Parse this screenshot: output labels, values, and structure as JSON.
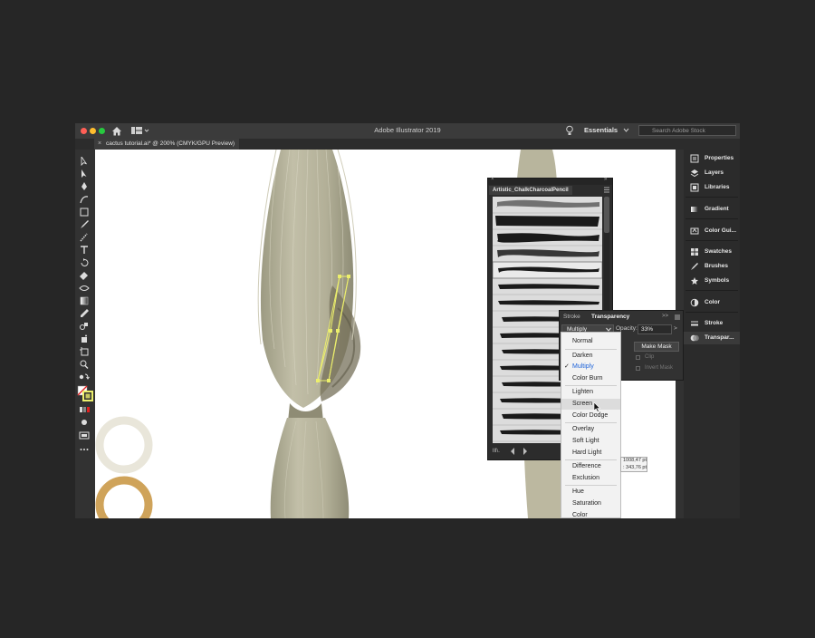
{
  "window": {
    "title": "Adobe Illustrator 2019",
    "workspace": "Essentials",
    "stock_search_placeholder": "Search Adobe Stock"
  },
  "document_tab": {
    "close": "×",
    "title": "cactus tutorial.ai* @ 200% (CMYK/GPU Preview)"
  },
  "dock": {
    "items": [
      {
        "label": "Properties"
      },
      {
        "label": "Layers"
      },
      {
        "label": "Libraries"
      },
      {
        "label": "Gradient"
      },
      {
        "label": "Color Gui..."
      },
      {
        "label": "Swatches"
      },
      {
        "label": "Brushes"
      },
      {
        "label": "Symbols"
      },
      {
        "label": "Color"
      },
      {
        "label": "Stroke"
      },
      {
        "label": "Transpar..."
      }
    ]
  },
  "brush_panel": {
    "tab": "Artistic_ChalkCharcoalPencil",
    "library_icon_text": "lll\\."
  },
  "transparency_panel": {
    "tabs": [
      "Stroke",
      "Transparency"
    ],
    "blend_mode": "Multiply",
    "opacity_label": "Opacity:",
    "opacity_value": "33%",
    "opacity_arrow": ">",
    "make_mask": "Make Mask",
    "clip": "Clip",
    "invert_mask": "Invert Mask",
    "expand": ">>"
  },
  "blend_menu": {
    "items": [
      "Normal",
      "Darken",
      "Multiply",
      "Color Burn",
      "Lighten",
      "Screen",
      "Color Dodge",
      "Overlay",
      "Soft Light",
      "Hard Light",
      "Difference",
      "Exclusion",
      "Hue",
      "Saturation",
      "Color"
    ],
    "checked": "Multiply",
    "hovered": "Screen",
    "check_mark": "✓"
  },
  "coordinates": {
    "x": "X: 1008,47 pt",
    "y": "Y: 343,76 pt"
  },
  "colors": {
    "accent": "#1e63d9",
    "stem": "#b6b39a",
    "ring_light": "#e9e6da",
    "ring_gold": "#cfa35a",
    "selection": "#ecef6c"
  }
}
